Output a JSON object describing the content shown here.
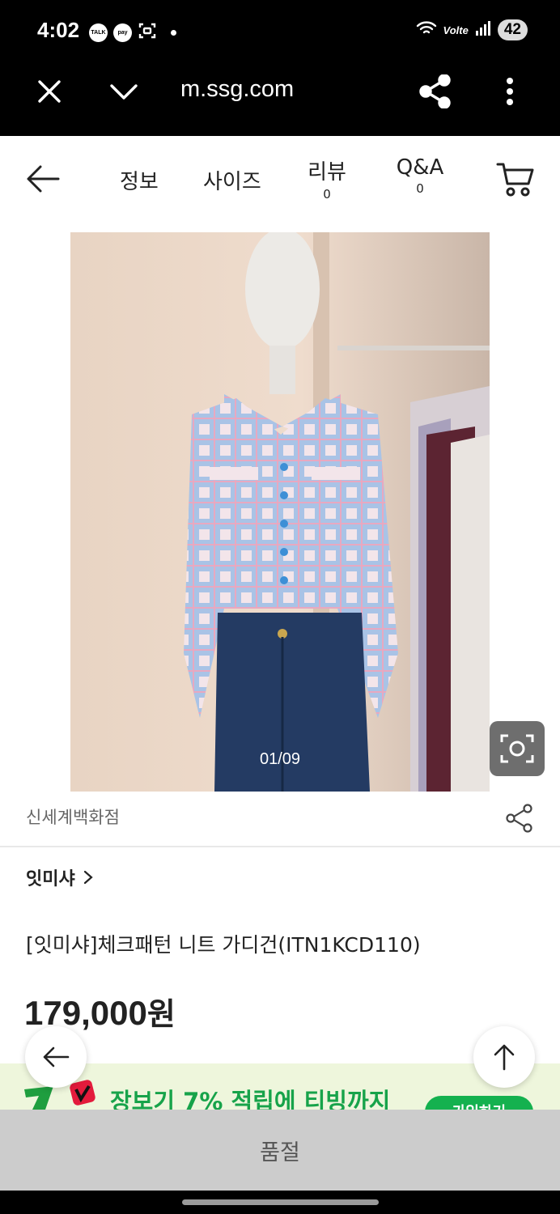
{
  "status_bar": {
    "time": "4:02",
    "notification_icons": [
      "TALK",
      "pay"
    ],
    "network": "Volte",
    "battery": "42"
  },
  "browser": {
    "url": "m.ssg.com",
    "icons": [
      "close-icon",
      "chevron-down-icon",
      "share-icon",
      "more-vertical-icon"
    ]
  },
  "page_nav": {
    "tabs": [
      {
        "label": "정보"
      },
      {
        "label": "사이즈"
      },
      {
        "label": "리뷰",
        "count": "0"
      },
      {
        "label": "Q&A",
        "count": "0"
      }
    ]
  },
  "product": {
    "image_counter": "01/09",
    "store": "신세계백화점",
    "brand": "잇미샤",
    "title": "[잇미샤]체크패턴 니트 가디건(ITN1KCD110)",
    "price": "179,000",
    "currency": "원"
  },
  "promo": {
    "text": "장보기 7% 적립에 티빙까지",
    "button_label": "가입하기"
  },
  "bottom_bar": {
    "label": "품절"
  },
  "colors": {
    "status_bar_bg": "#000000",
    "promo_green": "#17a34a",
    "soldout_bg": "#cccccc"
  }
}
